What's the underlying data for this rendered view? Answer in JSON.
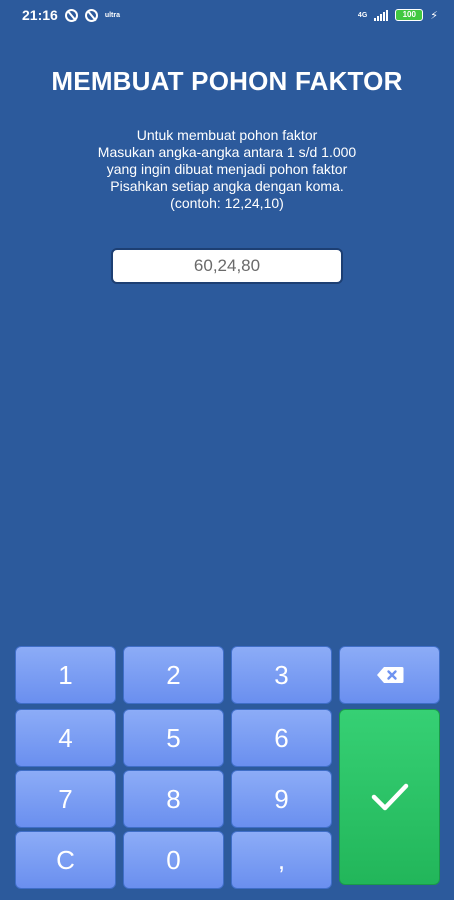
{
  "status_bar": {
    "time": "21:16",
    "mini_label": "ultra",
    "network": "4G",
    "battery": "100"
  },
  "title": "MEMBUAT POHON FAKTOR",
  "instructions": [
    "Untuk membuat pohon faktor",
    "Masukan angka-angka antara 1 s/d 1.000",
    "yang ingin dibuat menjadi pohon faktor",
    "Pisahkan setiap angka dengan koma.",
    "(contoh: 12,24,10)"
  ],
  "input": {
    "value": "60,24,80"
  },
  "keypad": {
    "k1": "1",
    "k2": "2",
    "k3": "3",
    "k4": "4",
    "k5": "5",
    "k6": "6",
    "k7": "7",
    "k8": "8",
    "k9": "9",
    "clear": "C",
    "k0": "0",
    "comma": ","
  },
  "colors": {
    "background": "#2c5a9c",
    "key": "#7b9ef4",
    "enter": "#2ec46a"
  },
  "icons": {
    "backspace": "backspace-icon",
    "enter": "check-icon"
  }
}
